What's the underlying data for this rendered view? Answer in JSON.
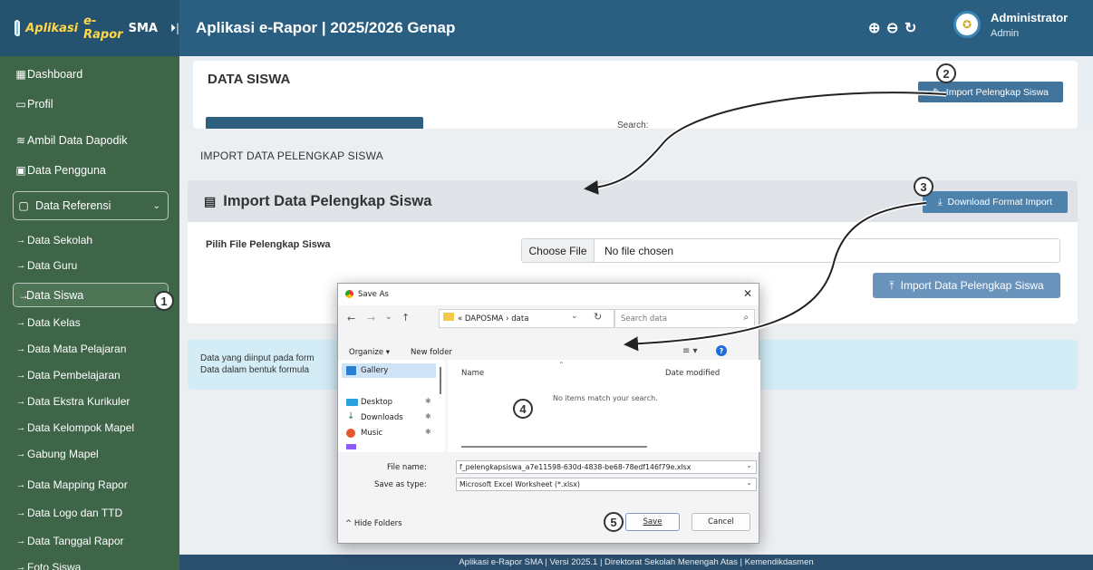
{
  "topbar": {
    "brand_prefix": "Aplikasi",
    "brand_main": "e-Rapor",
    "brand_suffix": "SMA",
    "app_title": "Aplikasi e-Rapor | 2025/2026 Genap",
    "user_name": "Administrator",
    "user_role": "Admin"
  },
  "sidebar": {
    "items": [
      {
        "label": "Dashboard"
      },
      {
        "label": "Profil"
      },
      {
        "label": "Ambil Data Dapodik"
      },
      {
        "label": "Data Pengguna"
      },
      {
        "label": "Data Referensi"
      },
      {
        "label": "Data Sekolah"
      },
      {
        "label": "Data Guru"
      },
      {
        "label": "Data Siswa"
      },
      {
        "label": "Data Kelas"
      },
      {
        "label": "Data Mata Pelajaran"
      },
      {
        "label": "Data Pembelajaran"
      },
      {
        "label": "Data Ekstra Kurikuler"
      },
      {
        "label": "Data Kelompok Mapel"
      },
      {
        "label": "Gabung Mapel"
      },
      {
        "label": "Data Mapping Rapor"
      },
      {
        "label": "Data Logo dan TTD"
      },
      {
        "label": "Data Tanggal Rapor"
      },
      {
        "label": "Foto Siswa"
      }
    ]
  },
  "page": {
    "title": "DATA SISWA",
    "import_pelengkap_button": "Import Pelengkap Siswa",
    "search_label": "Search:"
  },
  "modal": {
    "title": "IMPORT DATA PELENGKAP SISWA",
    "header": "Import Data Pelengkap Siswa",
    "download_button": "Download Format Import",
    "file_label": "Pilih File Pelengkap Siswa",
    "choose_file": "Choose File",
    "no_file": "No file chosen",
    "import_button": "Import Data Pelengkap Siswa"
  },
  "info": {
    "line1": "Data yang diinput pada form",
    "line2": "Data dalam bentuk formula"
  },
  "footer": "Aplikasi e-Rapor SMA | Versi 2025.1 | Direktorat Sekolah Menengah Atas | Kemendikdasmen",
  "save_dialog": {
    "title": "Save As",
    "breadcrumb": "« DAPOSMA › data",
    "search_placeholder": "Search data",
    "organize": "Organize ▾",
    "new_folder": "New folder",
    "nav_items": [
      "Gallery",
      "Desktop",
      "Downloads",
      "Music"
    ],
    "col_name": "Name",
    "col_date": "Date modified",
    "empty_msg": "No items match your search.",
    "file_name_label": "File name:",
    "file_name_value": "f_pelengkapsiswa_a7e11598-630d-4838-be68-78edf146f79e.xlsx",
    "save_type_label": "Save as type:",
    "save_type_value": "Microsoft Excel Worksheet (*.xlsx)",
    "hide_folders": "Hide Folders",
    "save_button": "Save",
    "cancel_button": "Cancel"
  },
  "steps": [
    "1",
    "2",
    "3",
    "4",
    "5"
  ]
}
